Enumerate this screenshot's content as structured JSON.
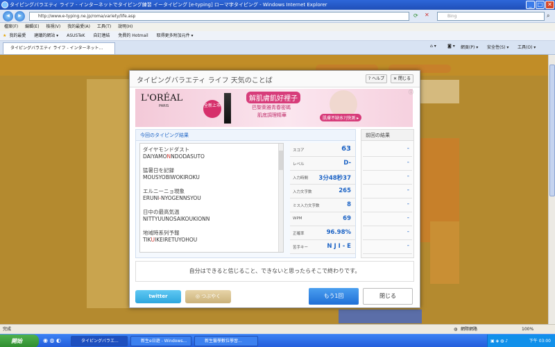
{
  "browser": {
    "window_title": "タイピングバラエティ ライフ - インターネットでタイピング練習 イータイピング [e-typing] ローマ字タイピング - Windows Internet Explorer",
    "address": "http://www.e-typing.ne.jp/roma/variety/life.asp",
    "search_placeholder": "Bing",
    "menu": [
      "檔案(F)",
      "編輯(E)",
      "檢視(V)",
      "我的最愛(A)",
      "工具(T)",
      "說明(H)"
    ],
    "favorites": [
      "我的最愛",
      "建議的網站 ▾",
      "ASUSTeK",
      "自訂連結",
      "免費的 Hotmail",
      "取得更多附加元件 ▾"
    ],
    "tab_title": "タイピングバラエティ ライフ - インターネット...",
    "commands": {
      "page": "網頁(P) ▾",
      "safety": "安全性(S) ▾",
      "tools": "工具(O) ▾"
    },
    "status_left": "完成",
    "status_right": "網際網路",
    "zoom": "100%"
  },
  "modal": {
    "title": "タイピングバラエティ ライフ 天気のことば",
    "help": "ヘルプ",
    "close_top": "閉じる",
    "current_label": "今回のタイピング結果",
    "previous_label": "前回の結果",
    "words": [
      {
        "jp": "ダイヤモンドダスト",
        "romaji": [
          "DAIYAMO",
          "N",
          "NDODASUTO"
        ]
      },
      {
        "jp": "猛暑日を記録",
        "romaji": [
          "MOUSYOBIWOKIROKU",
          "",
          ""
        ]
      },
      {
        "jp": "エルニーニョ現象",
        "romaji": [
          "ERUNI",
          "-",
          "NYOGENNSYOU"
        ]
      },
      {
        "jp": "日中の最高気温",
        "romaji": [
          "NITTYUUNOSAIKOUKIONN",
          "",
          ""
        ]
      },
      {
        "jp": "地域時系列予報",
        "romaji": [
          "TIK",
          "U",
          "IKEIRETUYOHOU"
        ]
      }
    ],
    "stats": [
      {
        "label": "スコア",
        "value": "63"
      },
      {
        "label": "レベル",
        "value": "D-"
      },
      {
        "label": "入力時間",
        "value": "3分48秒37"
      },
      {
        "label": "入力文字数",
        "value": "265"
      },
      {
        "label": "ミス入力文字数",
        "value": "8"
      },
      {
        "label": "WPM",
        "value": "69"
      },
      {
        "label": "正確率",
        "value": "96.98%"
      },
      {
        "label": "苦手キー",
        "value": "N J I - E"
      }
    ],
    "previous": [
      "-",
      "-",
      "-",
      "-",
      "-",
      "-",
      "-",
      "-"
    ],
    "quote": "自分はできると信じること、できないと思ったらそこで終わりです。",
    "twitter": "twitter",
    "tweet": "つぶやく",
    "retry": "もう1回",
    "close": "閉じる"
  },
  "ad": {
    "brand": "L'ORÉAL",
    "brand_sub": "PARIS",
    "badge": "全新上市",
    "headline": "解肌膚飢好裡子",
    "line1": "巴黎萊雅青春密碼",
    "line2": "肌底調理精華",
    "cta": "肌膚不缺水?|快測 ▸"
  },
  "taskbar": {
    "start": "開始",
    "tasks": [
      "タイピングバラエ...",
      "新生e日遊 - Windows...",
      "新生醫學數位學習..."
    ],
    "clock": "下午 03:00"
  },
  "colors": {
    "accent": "#1c63c5",
    "error": "#d1322b",
    "page_bg": "#b48a2f"
  }
}
